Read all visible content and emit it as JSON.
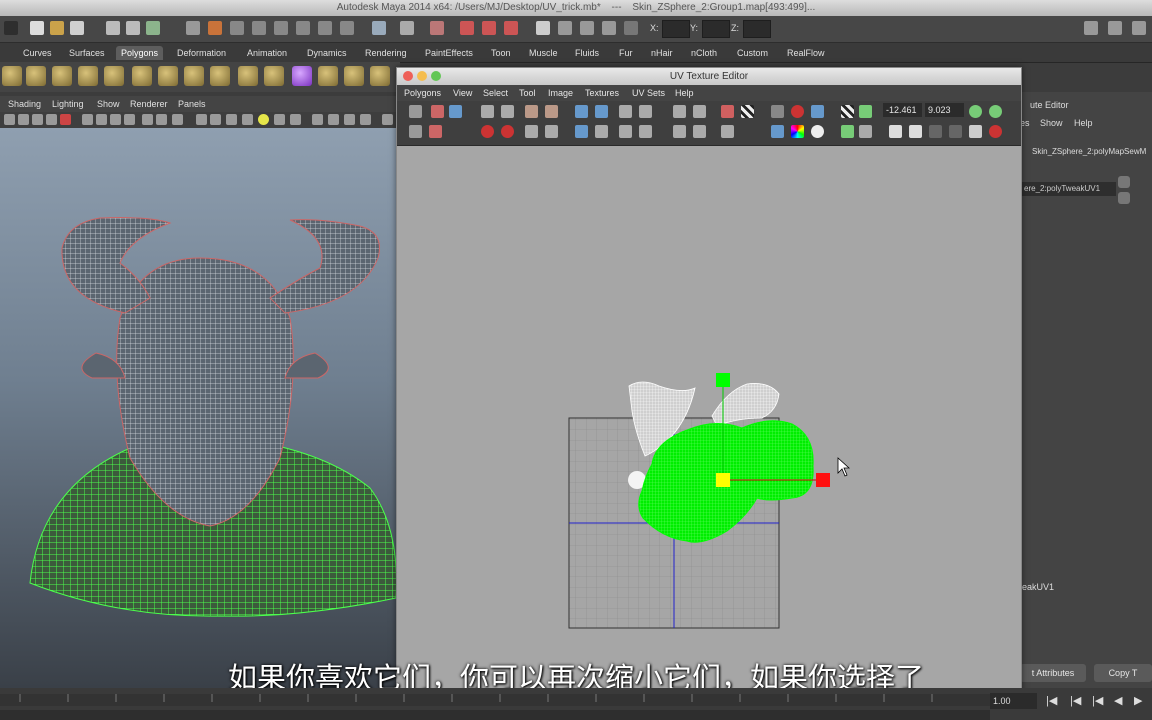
{
  "window": {
    "title": "Autodesk Maya 2014 x64: /Users/MJ/Desktop/UV_trick.mb*",
    "separator": "---",
    "title_context": "Skin_ZSphere_2:Group1.map[493:499]..."
  },
  "status_line": {
    "x_label": "X:",
    "y_label": "Y:",
    "z_label": "Z:"
  },
  "shelf_tabs": [
    "Curves",
    "Surfaces",
    "Polygons",
    "Deformation",
    "Animation",
    "Dynamics",
    "Rendering",
    "PaintEffects",
    "Toon",
    "Muscle",
    "Fluids",
    "Fur",
    "nHair",
    "nCloth",
    "Custom",
    "RealFlow"
  ],
  "shelf_active_tab": "Polygons",
  "viewport_menu": [
    "Shading",
    "Lighting",
    "Show",
    "Renderer",
    "Panels"
  ],
  "uv_editor": {
    "title": "UV Texture Editor",
    "menu": [
      "Polygons",
      "View",
      "Select",
      "Tool",
      "Image",
      "Textures",
      "UV Sets",
      "Help"
    ],
    "u_value": "-12.461",
    "v_value": "9.023"
  },
  "attr_editor": {
    "title_fragment": "ute Editor",
    "menu": [
      "es",
      "Show",
      "Help"
    ],
    "node_name": "Skin_ZSphere_2:polyMapSewM",
    "node_field": "ere_2:polyTweakUV1",
    "bottom_label": "eakUV1",
    "load_button": "t Attributes",
    "copy_button": "Copy T"
  },
  "timeline": {
    "frame_value": "1.00"
  },
  "subtitle": "如果你喜欢它们，你可以再次缩小它们，如果你选择了",
  "colors": {
    "selection": "#00ff00",
    "manip_center": "#ffff00",
    "manip_handle_red": "#ff0000",
    "accent_purple": "#a050ff"
  }
}
